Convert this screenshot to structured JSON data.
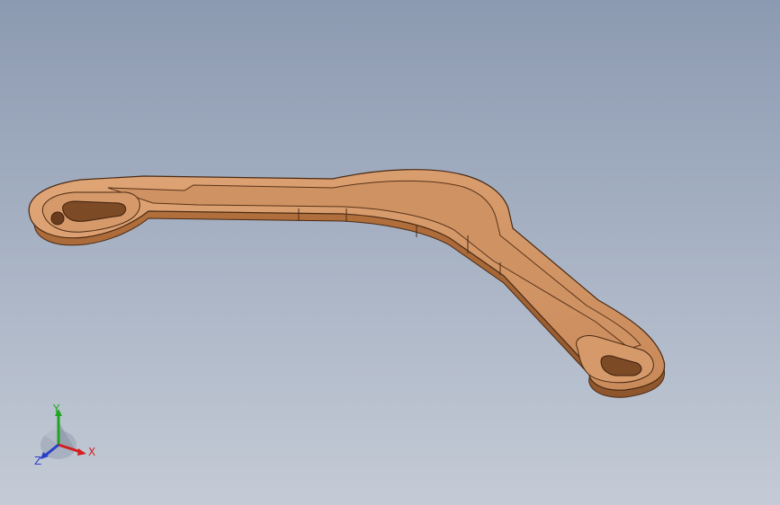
{
  "viewport": {
    "colors": {
      "background_top": "#8c9ab1",
      "background_bottom": "#c4cbd6",
      "part_top": "#d79a6a",
      "part_side": "#a9693c",
      "part_edge": "#4a2a14"
    }
  },
  "triad": {
    "x_label": "X",
    "y_label": "Y",
    "z_label": "Z",
    "colors": {
      "x": "#d21f1f",
      "y": "#1fa51f",
      "z": "#2a3fc9"
    }
  }
}
